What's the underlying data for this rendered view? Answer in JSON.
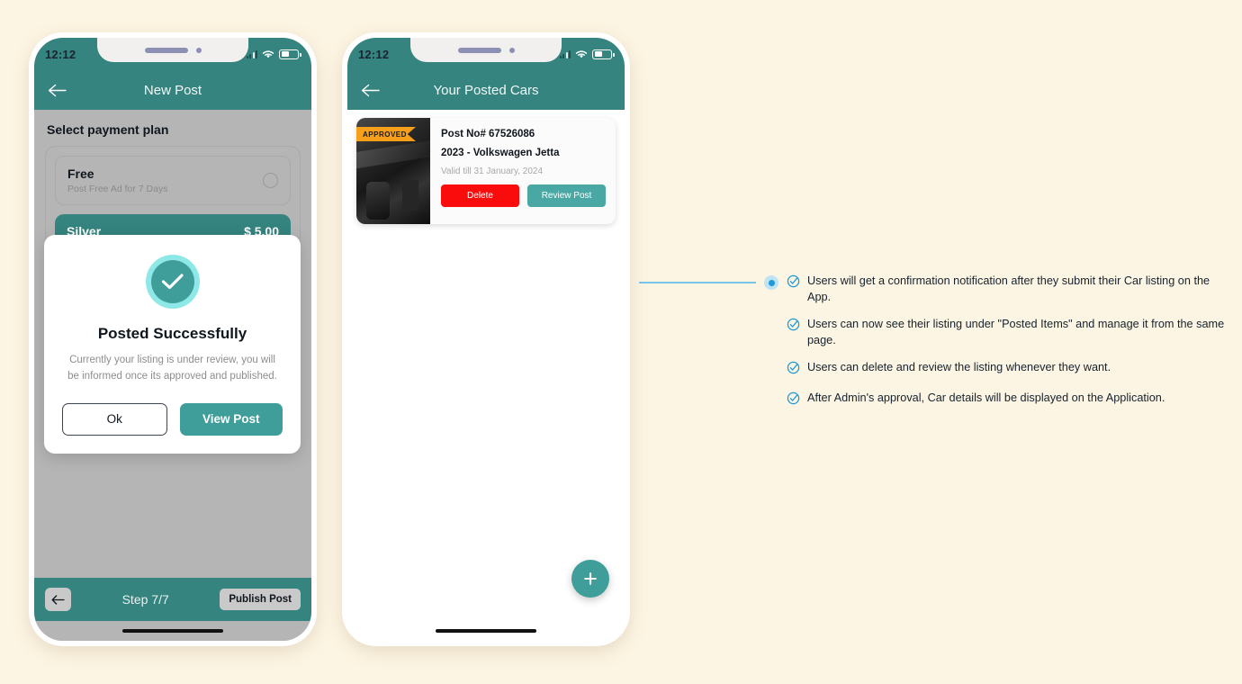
{
  "background_color": "#fdf5e3",
  "accent_teal": "#35847f",
  "accent_teal_light": "#3f9e9a",
  "accent_blue": "#1f9ad6",
  "accent_orange": "#f59f1b",
  "accent_red": "#fb0c0c",
  "phone1": {
    "status": {
      "time": "12:12",
      "signal_icon": "signal-bars-icon",
      "wifi_icon": "wifi-icon",
      "battery_icon": "battery-icon"
    },
    "header": {
      "back_icon": "back-arrow-icon",
      "title": "New Post"
    },
    "section_title": "Select payment plan",
    "plans": [
      {
        "name": "Free",
        "subtitle": "Post Free Ad for 7 Days",
        "price": "",
        "selected": false
      },
      {
        "name": "Silver",
        "subtitle": "",
        "price": "$ 5.00",
        "selected": true
      }
    ],
    "modal": {
      "icon": "success-check-icon",
      "title": "Posted Successfully",
      "body": "Currently your listing is under review, you will be informed once its approved and published.",
      "primary_label": "View Post",
      "secondary_label": "Ok"
    },
    "footer": {
      "back_icon": "back-arrow-icon",
      "step_text": "Step 7/7",
      "publish_label": "Publish Post"
    }
  },
  "phone2": {
    "status": {
      "time": "12:12",
      "signal_icon": "signal-bars-icon",
      "wifi_icon": "wifi-icon",
      "battery_icon": "battery-icon"
    },
    "header": {
      "back_icon": "back-arrow-icon",
      "title": "Your Posted Cars"
    },
    "card": {
      "badge": "APPROVED",
      "thumbnail": "car-interior-photo",
      "post_no": "Post No# 67526086",
      "model": "2023 - Volkswagen Jetta",
      "valid_till": "Valid till  31 January, 2024",
      "delete_label": "Delete",
      "review_label": "Review Post"
    },
    "fab_icon": "plus-icon"
  },
  "annotations": {
    "marker": "connector-dot",
    "items": [
      {
        "icon": "check-circle-icon",
        "text": "Users will get a confirmation notification after they submit their Car listing on the App."
      },
      {
        "icon": "check-circle-icon",
        "text": "Users can now see their listing under \"Posted Items\" and manage it from the same page."
      },
      {
        "icon": "check-circle-icon",
        "text": "Users can delete and review the listing whenever they want."
      },
      {
        "icon": "check-circle-icon",
        "text": "After Admin's approval, Car details will be displayed on the Application."
      }
    ]
  }
}
